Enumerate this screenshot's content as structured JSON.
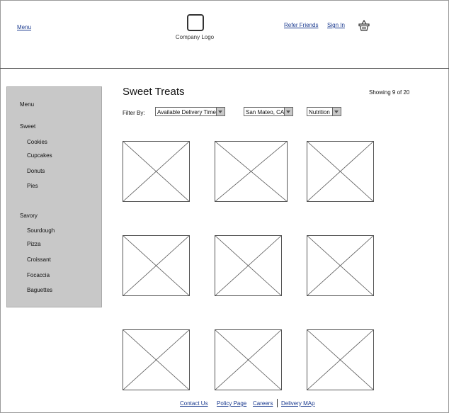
{
  "header": {
    "menu_label": "Menu",
    "logo_text": "Company Logo",
    "refer_label": "Refer Friends",
    "signin_label": "Sign In"
  },
  "sidebar": {
    "title": "Menu",
    "sections": [
      {
        "label": "Sweet",
        "items": [
          "Cookies",
          "Cupcakes",
          "Donuts",
          "Pies"
        ]
      },
      {
        "label": "Savory",
        "items": [
          "Sourdough",
          "Pizza",
          "Croissant",
          "Focaccia",
          "Baguettes"
        ]
      }
    ]
  },
  "main": {
    "title": "Sweet Treats",
    "showing": "Showing 9 of 20",
    "filter_label": "Filter By:",
    "filters": {
      "delivery": "Available Delivery Time",
      "location": "San Mateo, CA",
      "nutrition": "Nutrition"
    },
    "tile_count": 9
  },
  "footer": {
    "links": [
      "Contact Us",
      "Policy Page",
      "Careers",
      "Delivery MAp"
    ]
  },
  "colors": {
    "link": "#1a3a8f",
    "sidebar_bg": "#c8c8c8"
  },
  "icons": {
    "basket": "basket-icon",
    "placeholder": "image-placeholder-icon"
  }
}
